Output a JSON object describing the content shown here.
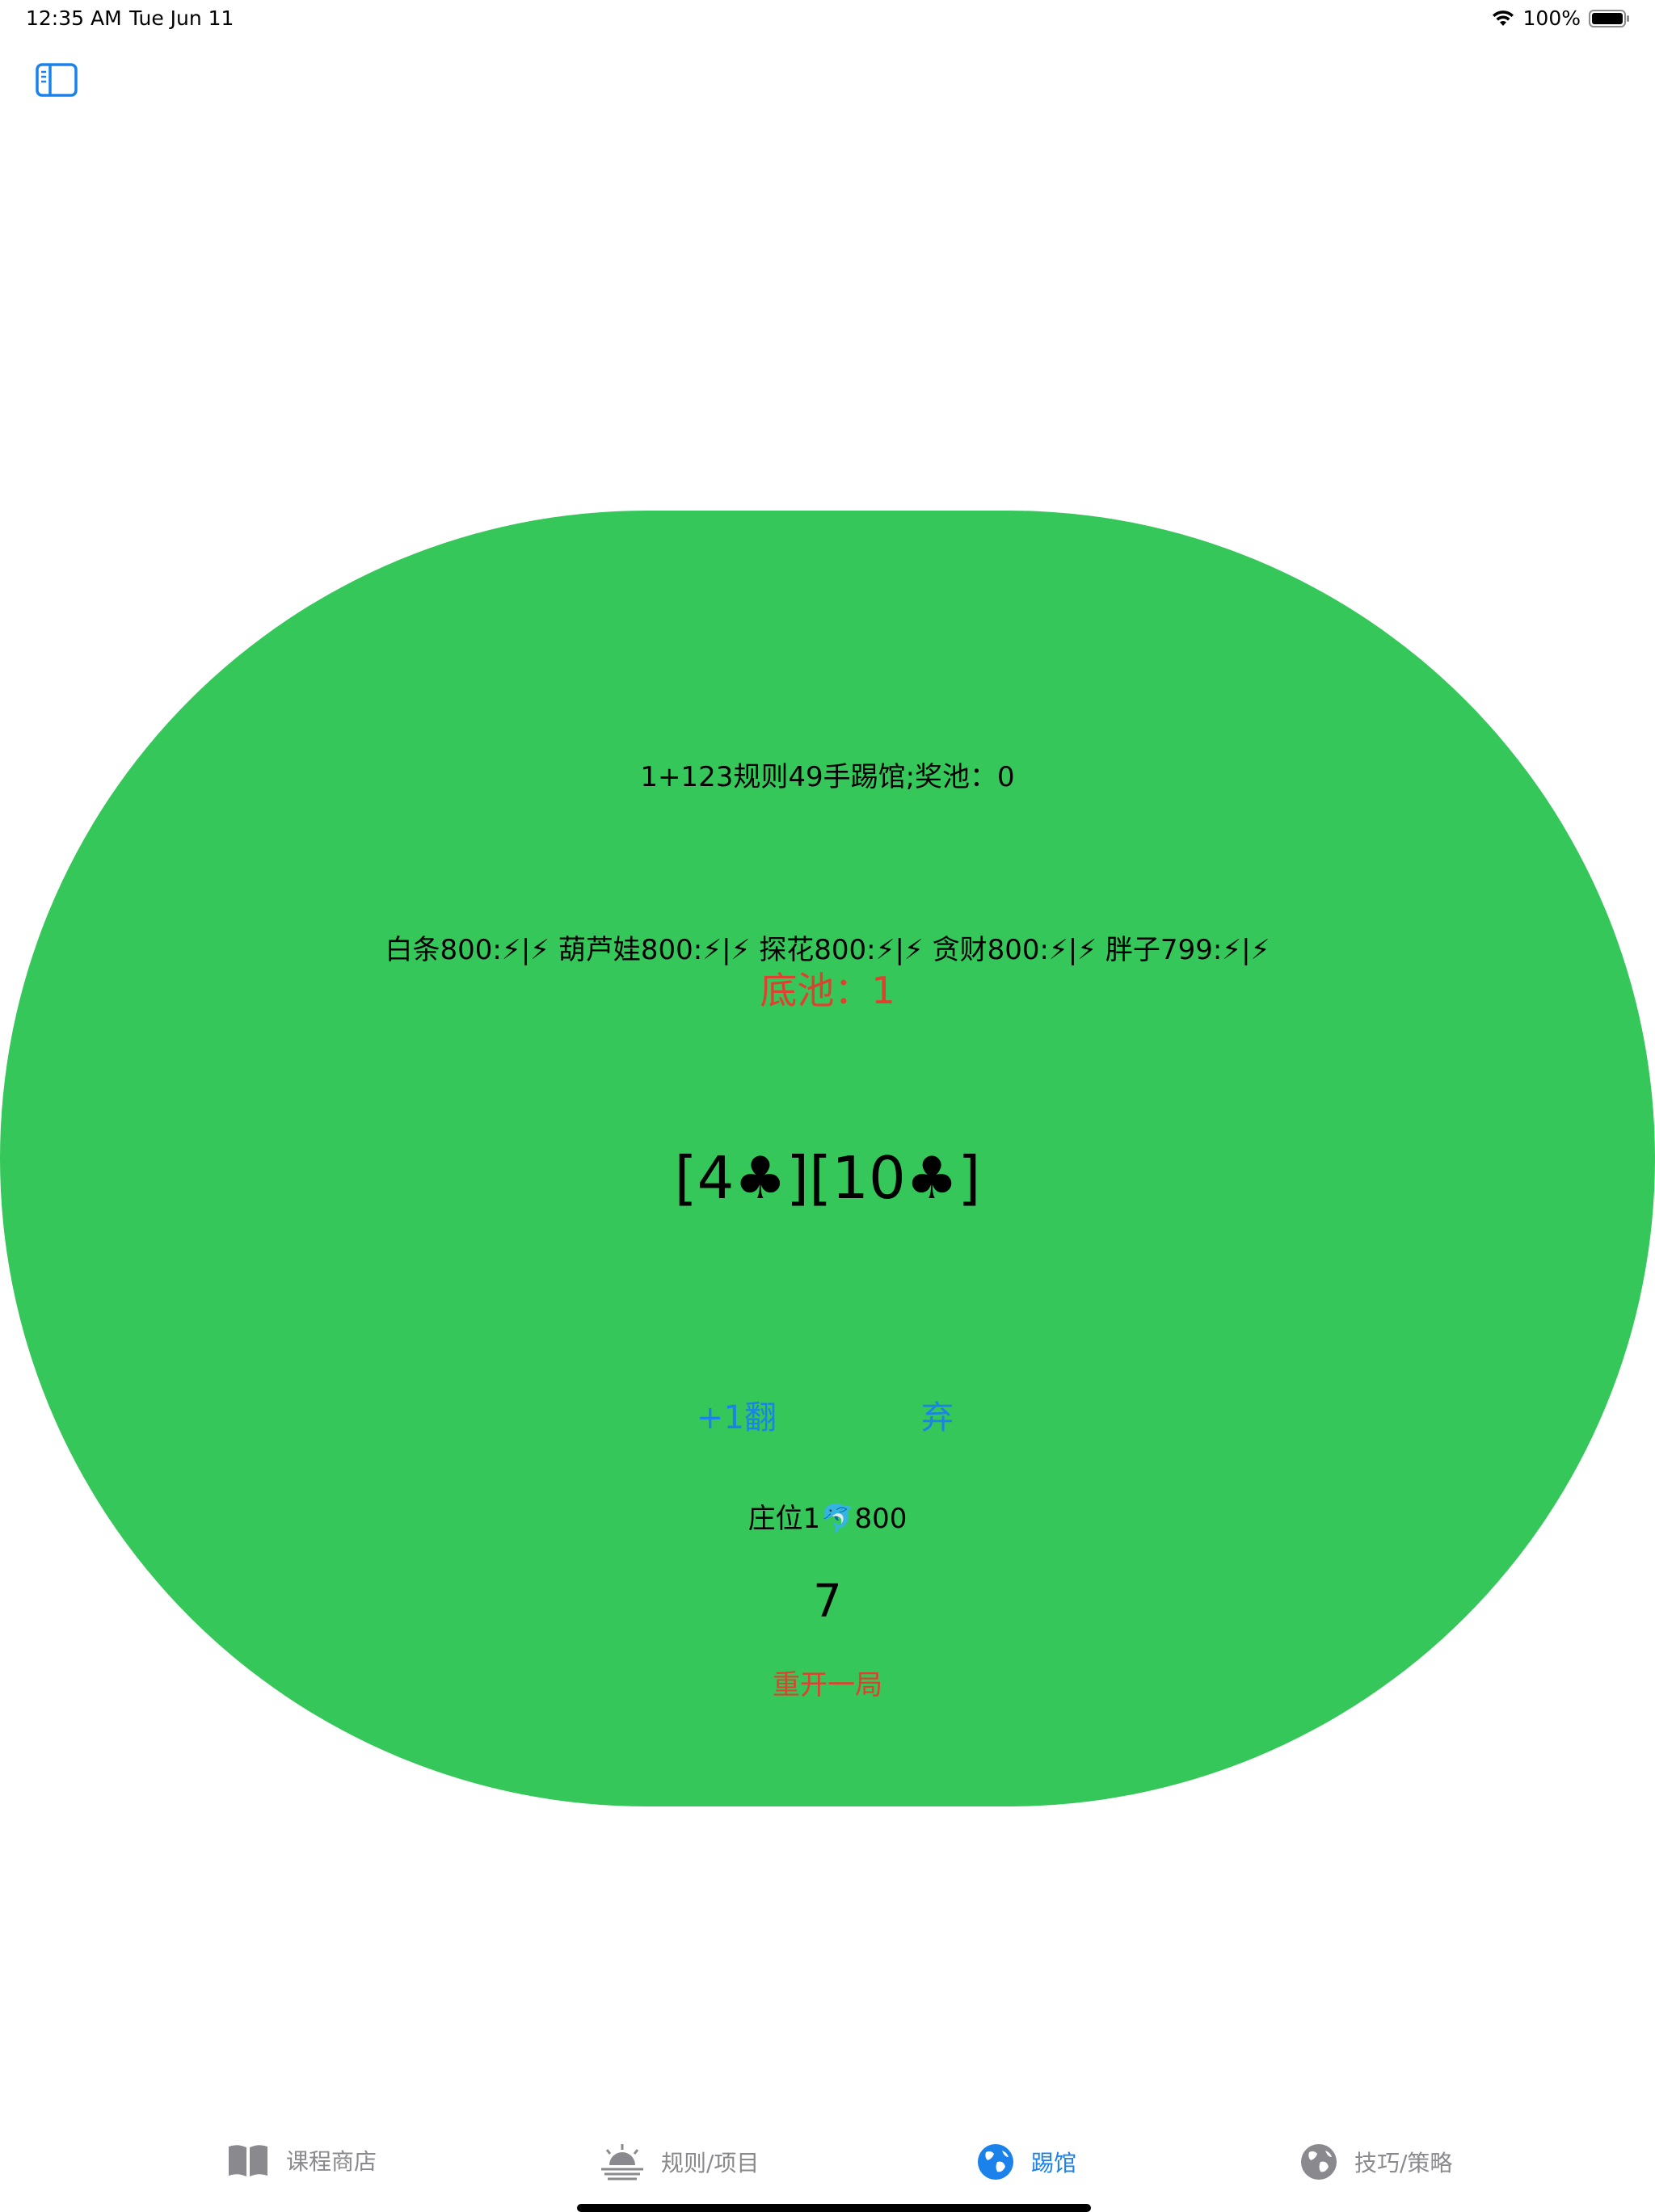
{
  "status_bar": {
    "time": "12:35 AM",
    "date": "Tue Jun 11",
    "battery": "100%"
  },
  "table": {
    "title": "1+123规则49手踢馆;奖池：0",
    "players": "白条800:⚡|⚡ 葫芦娃800:⚡|⚡ 探花800:⚡|⚡ 贪财800:⚡|⚡ 胖子799:⚡|⚡",
    "pot": "底池：1",
    "cards": "[4♣][10♣]",
    "raise_label": "+1翻",
    "fold_label": "弃",
    "dealer": "庄位1🐬800",
    "counter": "7",
    "restart_label": "重开一局"
  },
  "tabs": [
    {
      "label": "课程商店",
      "icon": "book-icon"
    },
    {
      "label": "规则/项目",
      "icon": "sunrise-icon"
    },
    {
      "label": "踢馆",
      "icon": "globe-icon"
    },
    {
      "label": "技巧/策略",
      "icon": "globe-icon"
    }
  ],
  "colors": {
    "felt": "#35c759",
    "accent": "#1a82ea",
    "alert": "#e0402f",
    "tab_inactive": "#8a8a8e"
  }
}
